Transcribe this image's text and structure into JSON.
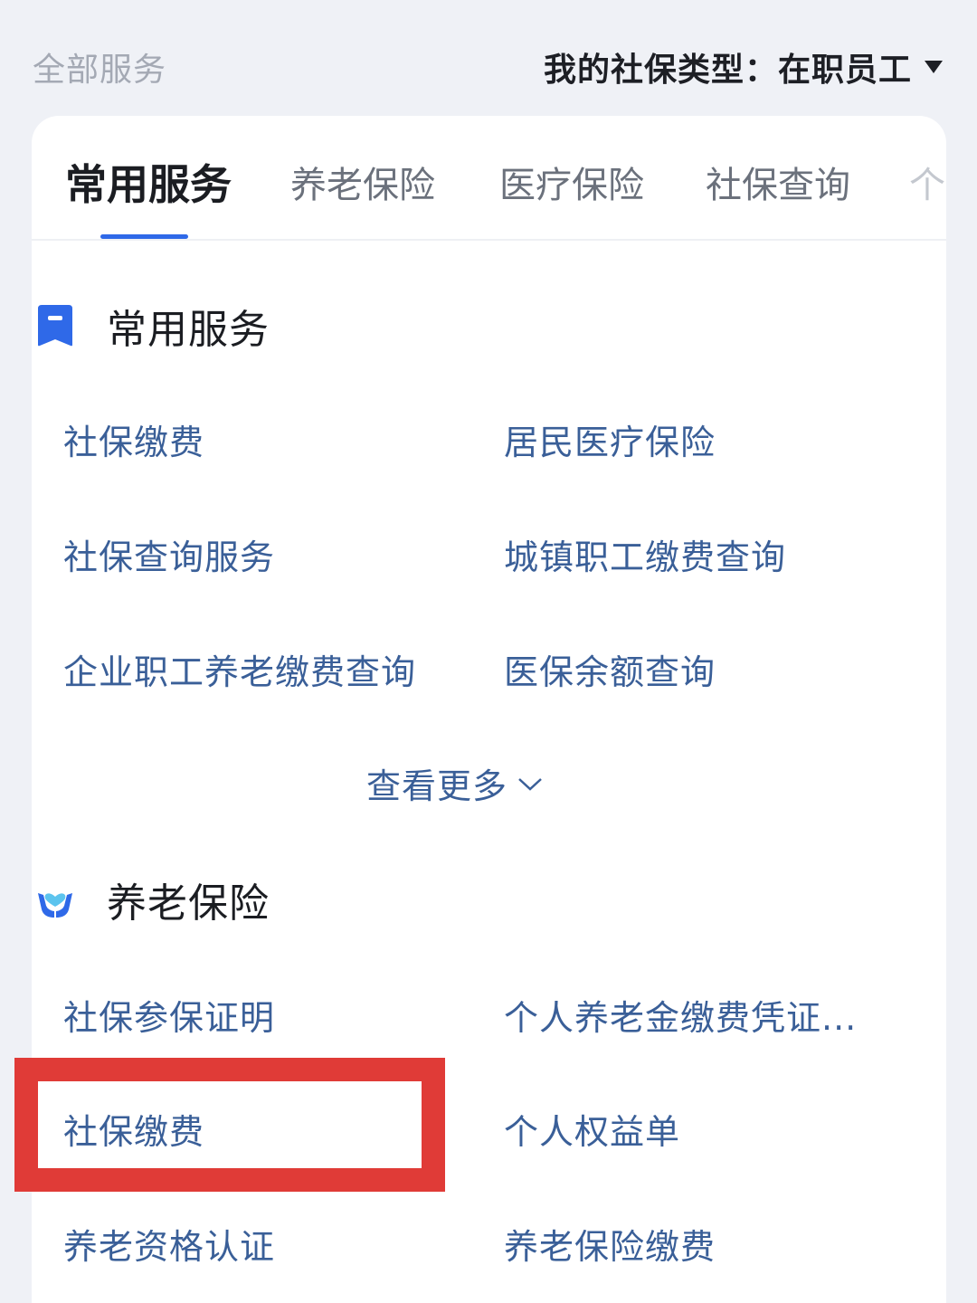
{
  "header": {
    "all_services": "全部服务",
    "ss_type": "我的社保类型：在职员工"
  },
  "tabs": [
    {
      "label": "常用服务",
      "active": true
    },
    {
      "label": "养老保险"
    },
    {
      "label": "医疗保险"
    },
    {
      "label": "社保查询"
    },
    {
      "label": "个"
    }
  ],
  "sections": [
    {
      "title": "常用服务",
      "icon": "bookmark-icon",
      "items": [
        "社保缴费",
        "居民医疗保险",
        "社保查询服务",
        "城镇职工缴费查询",
        "企业职工养老缴费查询",
        "医保余额查询"
      ],
      "more_label": "查看更多"
    },
    {
      "title": "养老保险",
      "icon": "hands-heart-icon",
      "items": [
        "社保参保证明",
        "个人养老金缴费凭证...",
        "社保缴费",
        "个人权益单",
        "养老资格认证",
        "养老保险缴费"
      ]
    }
  ],
  "colors": {
    "accent": "#2f69e8",
    "item_text": "#3a5f98",
    "highlight": "#e03b37",
    "background": "#eff1f6"
  }
}
